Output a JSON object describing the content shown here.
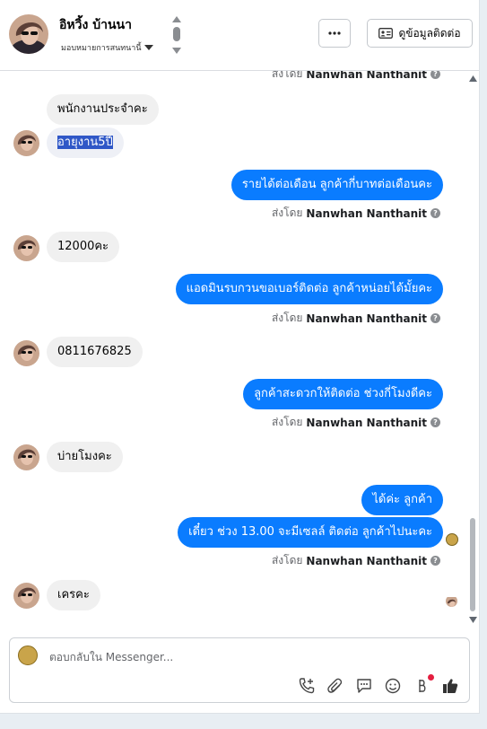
{
  "header": {
    "name": "อิหวิ้ง บ้านนา",
    "assign_label": "มอบหมายการสนทนานี้",
    "more_label": "···",
    "info_button": "ดูข้อมูลติดต่อ"
  },
  "sender": {
    "prefix": "ส่งโดย",
    "name": "Nanwhan Nanthanit",
    "info": "?"
  },
  "messages": {
    "in_1": "พนักงานประจำคะ",
    "in_2": "อายุงาน5ปี",
    "out_1": "รายได้ต่อเดือน ลูกค้ากี่บาทต่อเดือนคะ",
    "in_3": "12000คะ",
    "out_2": "แอดมินรบกวนขอเบอร์ติดต่อ ลูกค้าหน่อยได้มั้ยคะ",
    "in_4": "0811676825",
    "out_3": "ลูกค้าสะดวกให้ติดต่อ ช่วงกี่โมงดีคะ",
    "in_5": "บ่ายโมงคะ",
    "out_4": "ได้ค่ะ  ลูกค้า",
    "out_5": "เดี๋ยว ช่วง 13.00 จะมีเซลล์ ติดต่อ ลูกค้าไปนะคะ",
    "in_6": "เครคะ"
  },
  "composer": {
    "placeholder": "ตอบกลับใน Messenger...",
    "tools": [
      "phone-plus-icon",
      "attach-icon",
      "saved-reply-icon",
      "emoji-icon",
      "currency-icon",
      "like-icon"
    ]
  },
  "colors": {
    "outgoing": "#0a7cff",
    "incoming": "#f0f0f0",
    "selection": "#2f57c7"
  }
}
